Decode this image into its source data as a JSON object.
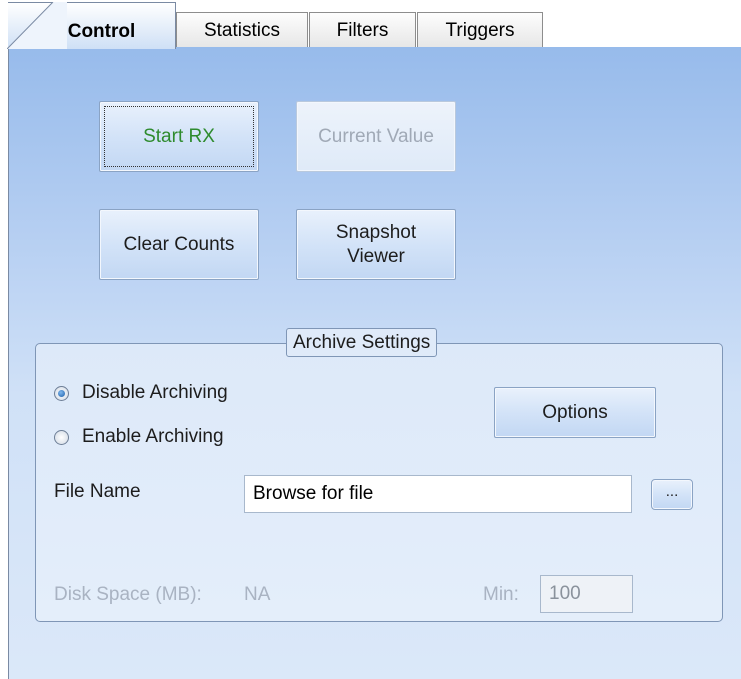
{
  "tabs": [
    {
      "label": "Control",
      "active": true
    },
    {
      "label": "Statistics",
      "active": false
    },
    {
      "label": "Filters",
      "active": false
    },
    {
      "label": "Triggers",
      "active": false
    }
  ],
  "buttons": {
    "start_rx": "Start RX",
    "current_value": "Current Value",
    "clear_counts": "Clear Counts",
    "snapshot_viewer_line1": "Snapshot",
    "snapshot_viewer_line2": "Viewer"
  },
  "archive": {
    "title": "Archive Settings",
    "disable_label": "Disable Archiving",
    "enable_label": "Enable Archiving",
    "selected": "Disable Archiving",
    "options_label": "Options",
    "file_name_label": "File Name",
    "file_name_value": "Browse for file",
    "browse_label": "...",
    "disk_space_label": "Disk Space (MB):",
    "disk_space_value": "NA",
    "min_label": "Min:",
    "min_value": "100"
  },
  "colors": {
    "start_rx_text": "#2e8b2e",
    "panel_top": "#97bbeb",
    "panel_bottom": "#dbe8f9"
  }
}
